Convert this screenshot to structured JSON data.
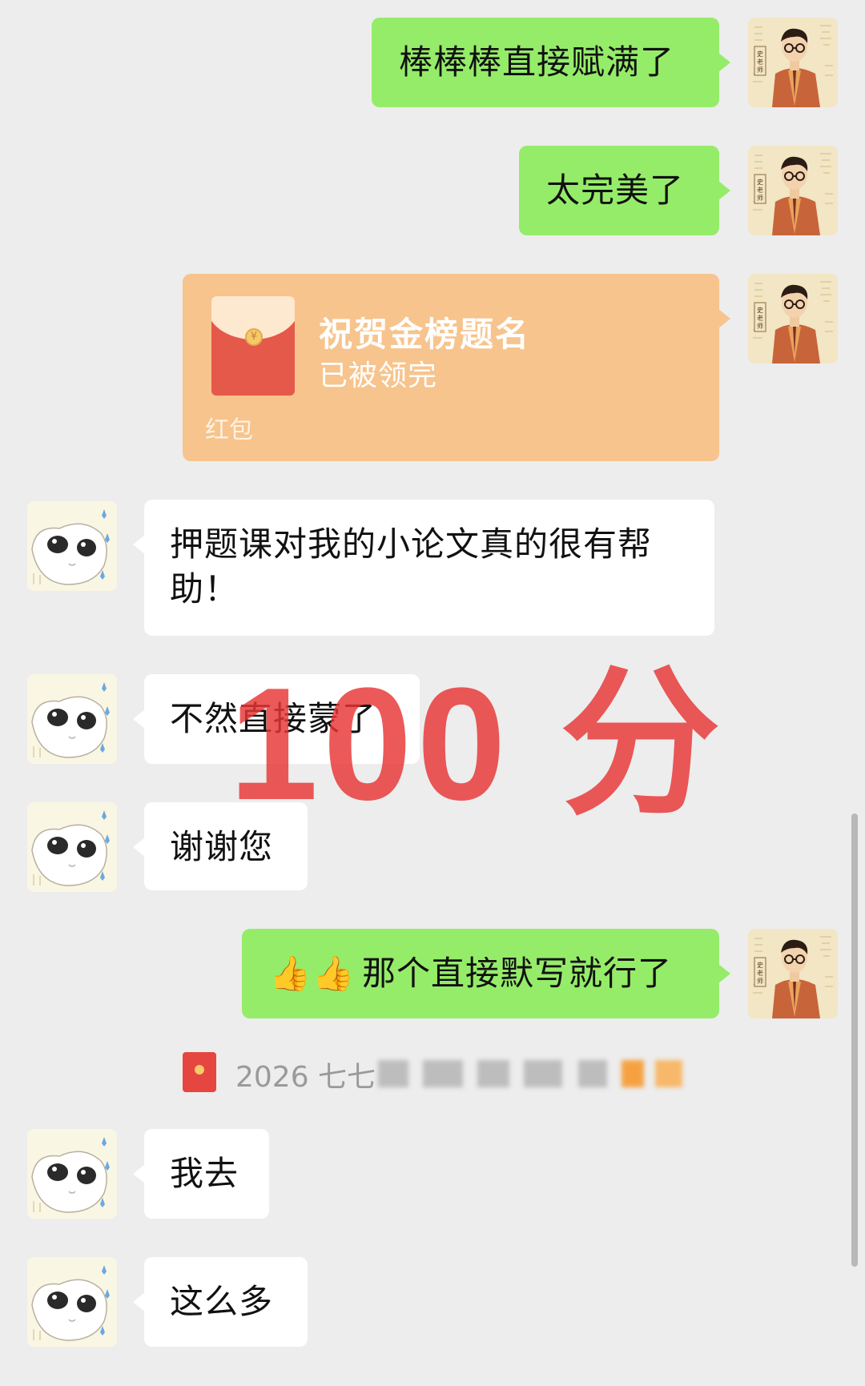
{
  "messages": {
    "m1": "棒棒棒直接赋满了",
    "m2": "太完美了",
    "m4": "押题课对我的小论文真的很有帮助！",
    "m5": "不然直接蒙了",
    "m6": "谢谢您",
    "m7": "那个直接默写就行了",
    "m8": "我去",
    "m9": "这么多"
  },
  "red_packet": {
    "title": "祝贺金榜题名",
    "status": "已被领完",
    "footer": "红包",
    "coin_glyph": "¥"
  },
  "notice": {
    "text": "2026 七七"
  },
  "overlay": {
    "text": "100 分"
  },
  "emoji": {
    "thumbs": "👍👍"
  },
  "colors": {
    "background": "#ededed",
    "sent_bubble": "#95ec69",
    "received_bubble": "#ffffff",
    "red_packet": "#f7c48d",
    "overlay_red": "#e83434"
  },
  "icons": {
    "teacher_avatar": "teacher-avatar-icon",
    "student_avatar": "student-avatar-icon",
    "red_packet": "red-packet-icon"
  }
}
